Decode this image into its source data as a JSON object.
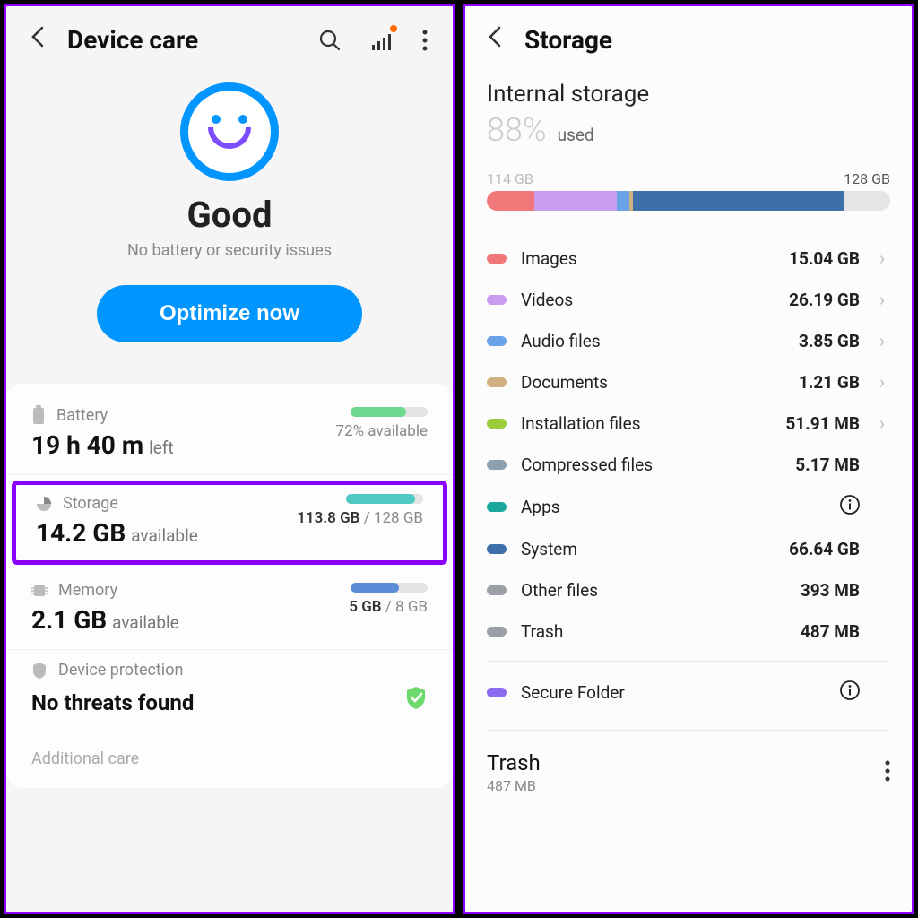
{
  "left": {
    "title": "Device care",
    "status": {
      "title": "Good",
      "subtitle": "No battery or security issues",
      "button": "Optimize now"
    },
    "battery": {
      "label": "Battery",
      "value": "19 h 40 m",
      "unit": "left",
      "meta": "72% available",
      "fill_pct": 72,
      "fill_color": "#6dd98e"
    },
    "storage": {
      "label": "Storage",
      "value": "14.2 GB",
      "unit": "available",
      "used": "113.8 GB",
      "total": "128 GB",
      "fill_pct": 89,
      "fill_color": "#4ec9c4"
    },
    "memory": {
      "label": "Memory",
      "value": "2.1 GB",
      "unit": "available",
      "used": "5 GB",
      "total": "8 GB",
      "fill_pct": 63,
      "fill_color": "#5a8bd6"
    },
    "protection": {
      "label": "Device protection",
      "value": "No threats found"
    },
    "additional": "Additional care"
  },
  "right": {
    "title": "Storage",
    "section_title": "Internal storage",
    "percent": "88%",
    "percent_label": "used",
    "bar_left": "114 GB",
    "bar_right": "128 GB",
    "segments": [
      {
        "color": "#f07878",
        "pct": 11.8
      },
      {
        "color": "#c89cf0",
        "pct": 20.5
      },
      {
        "color": "#6aa3e8",
        "pct": 3.0
      },
      {
        "color": "#d0b080",
        "pct": 1.0
      },
      {
        "color": "#3d6fa8",
        "pct": 52.1
      }
    ],
    "categories": [
      {
        "name": "Images",
        "value": "15.04 GB",
        "color": "#f07878",
        "chev": true
      },
      {
        "name": "Videos",
        "value": "26.19 GB",
        "color": "#c89cf0",
        "chev": true
      },
      {
        "name": "Audio files",
        "value": "3.85 GB",
        "color": "#6aa3e8",
        "chev": true
      },
      {
        "name": "Documents",
        "value": "1.21 GB",
        "color": "#d0b080",
        "chev": true
      },
      {
        "name": "Installation files",
        "value": "51.91 MB",
        "color": "#9ccc3c",
        "chev": true
      },
      {
        "name": "Compressed files",
        "value": "5.17 MB",
        "color": "#8ea0b0",
        "chev": false
      },
      {
        "name": "Apps",
        "value": "",
        "color": "#1aa89e",
        "info": true
      },
      {
        "name": "System",
        "value": "66.64 GB",
        "color": "#3d6fa8",
        "chev": false
      },
      {
        "name": "Other files",
        "value": "393 MB",
        "color": "#9aa0a6",
        "chev": false
      },
      {
        "name": "Trash",
        "value": "487 MB",
        "color": "#9aa0a6",
        "chev": false
      },
      {
        "name": "Secure Folder",
        "value": "",
        "color": "#8b6cf0",
        "info": true,
        "divider_before": true
      }
    ],
    "trash": {
      "title": "Trash",
      "sub": "487 MB"
    }
  }
}
